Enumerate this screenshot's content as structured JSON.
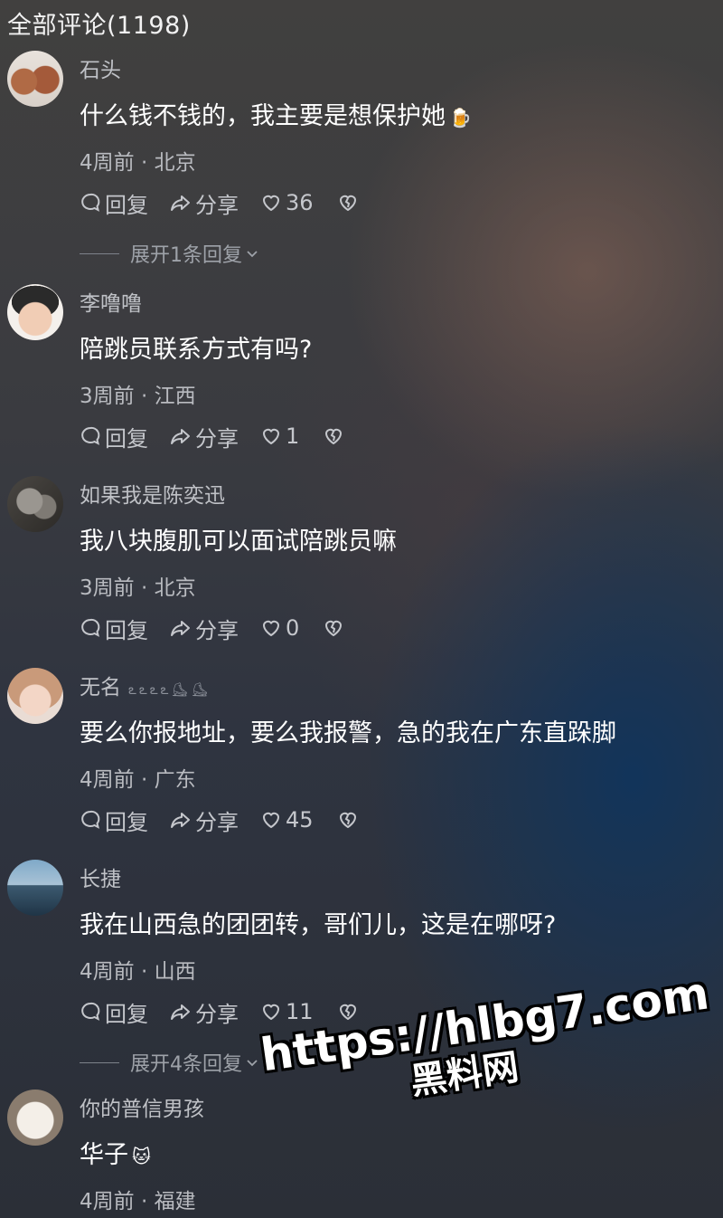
{
  "header": {
    "title": "全部评论(1198)"
  },
  "actions": {
    "reply": "回复",
    "share": "分享"
  },
  "comments": [
    {
      "user": "石头",
      "text": "什么钱不钱的，我主要是想保护她",
      "emoji": "🍺",
      "meta": "4周前 · 北京",
      "likes": "36",
      "expand": "展开1条回复"
    },
    {
      "user": "李噜噜",
      "text": "陪跳员联系方式有吗?",
      "meta": "3周前 · 江西",
      "likes": "1"
    },
    {
      "user": "如果我是陈奕迅",
      "text": "我八块腹肌可以面试陪跳员嘛",
      "meta": "3周前 · 北京",
      "likes": "0"
    },
    {
      "user": "无名",
      "user_deco": "ఽఽఽఽ⛸⛸",
      "text": "要么你报地址，要么我报警，急的我在广东直跺脚",
      "meta": "4周前 · 广东",
      "likes": "45"
    },
    {
      "user": "长捷",
      "text": "我在山西急的团团转，哥们儿，这是在哪呀?",
      "meta": "4周前 · 山西",
      "likes": "11",
      "expand": "展开4条回复"
    },
    {
      "user": "你的普信男孩",
      "text": "华子",
      "emoji": "🐱",
      "meta": "4周前 · 福建"
    }
  ],
  "watermark": {
    "url": "https://hlbg7.com",
    "brand": "黑料网"
  }
}
